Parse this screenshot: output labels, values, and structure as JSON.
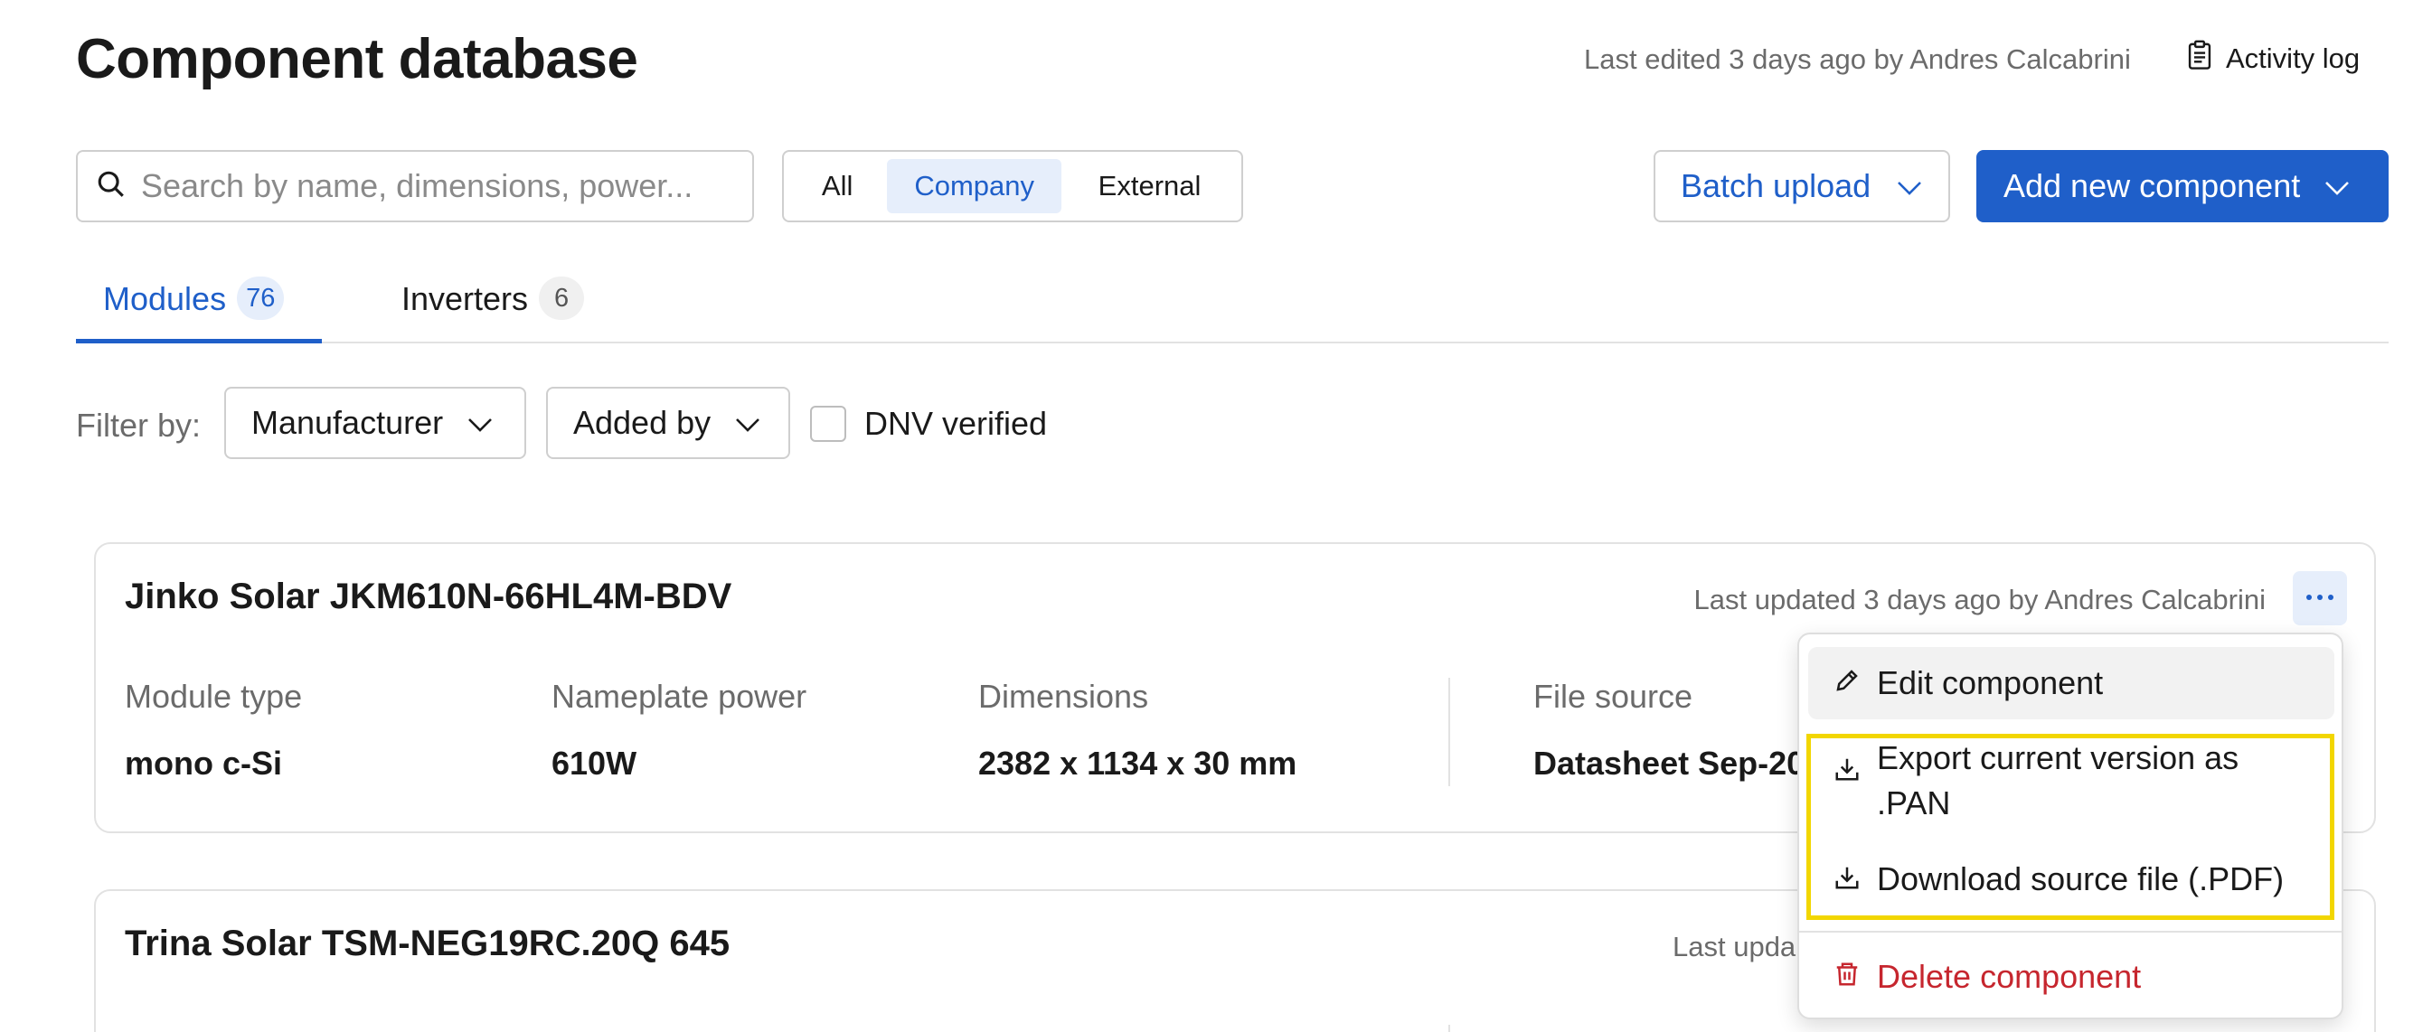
{
  "header": {
    "title": "Component database",
    "last_edited": "Last edited 3 days ago by Andres Calcabrini",
    "activity_log": "Activity log"
  },
  "toolbar": {
    "search_placeholder": "Search by name, dimensions, power...",
    "segments": [
      "All",
      "Company",
      "External"
    ],
    "selected_segment": "Company",
    "batch_upload": "Batch upload",
    "add_new": "Add new component"
  },
  "tabs": [
    {
      "label": "Modules",
      "count": "76"
    },
    {
      "label": "Inverters",
      "count": "6"
    }
  ],
  "filters": {
    "label": "Filter by:",
    "manufacturer": "Manufacturer",
    "added_by": "Added by",
    "dnv_verified": "DNV verified"
  },
  "cards": [
    {
      "title": "Jinko Solar JKM610N-66HL4M-BDV",
      "updated": "Last updated 3 days ago by Andres Calcabrini",
      "fields": [
        {
          "label": "Module type",
          "value": "mono c-Si"
        },
        {
          "label": "Nameplate power",
          "value": "610W"
        },
        {
          "label": "Dimensions",
          "value": "2382 x 1134 x 30 mm"
        },
        {
          "label": "File source",
          "value": "Datasheet Sep-20"
        }
      ]
    },
    {
      "title": "Trina Solar TSM-NEG19RC.20Q 645",
      "updated": "Last upda"
    }
  ],
  "menu": {
    "edit": "Edit component",
    "export_line1": "Export current version as",
    "export_line2": ".PAN",
    "download": "Download source file (.PDF)",
    "delete": "Delete component"
  },
  "colors": {
    "accent": "#1f5fc9",
    "accent_light": "#e6eefb",
    "danger": "#c6262e",
    "highlight": "#f2d600"
  }
}
